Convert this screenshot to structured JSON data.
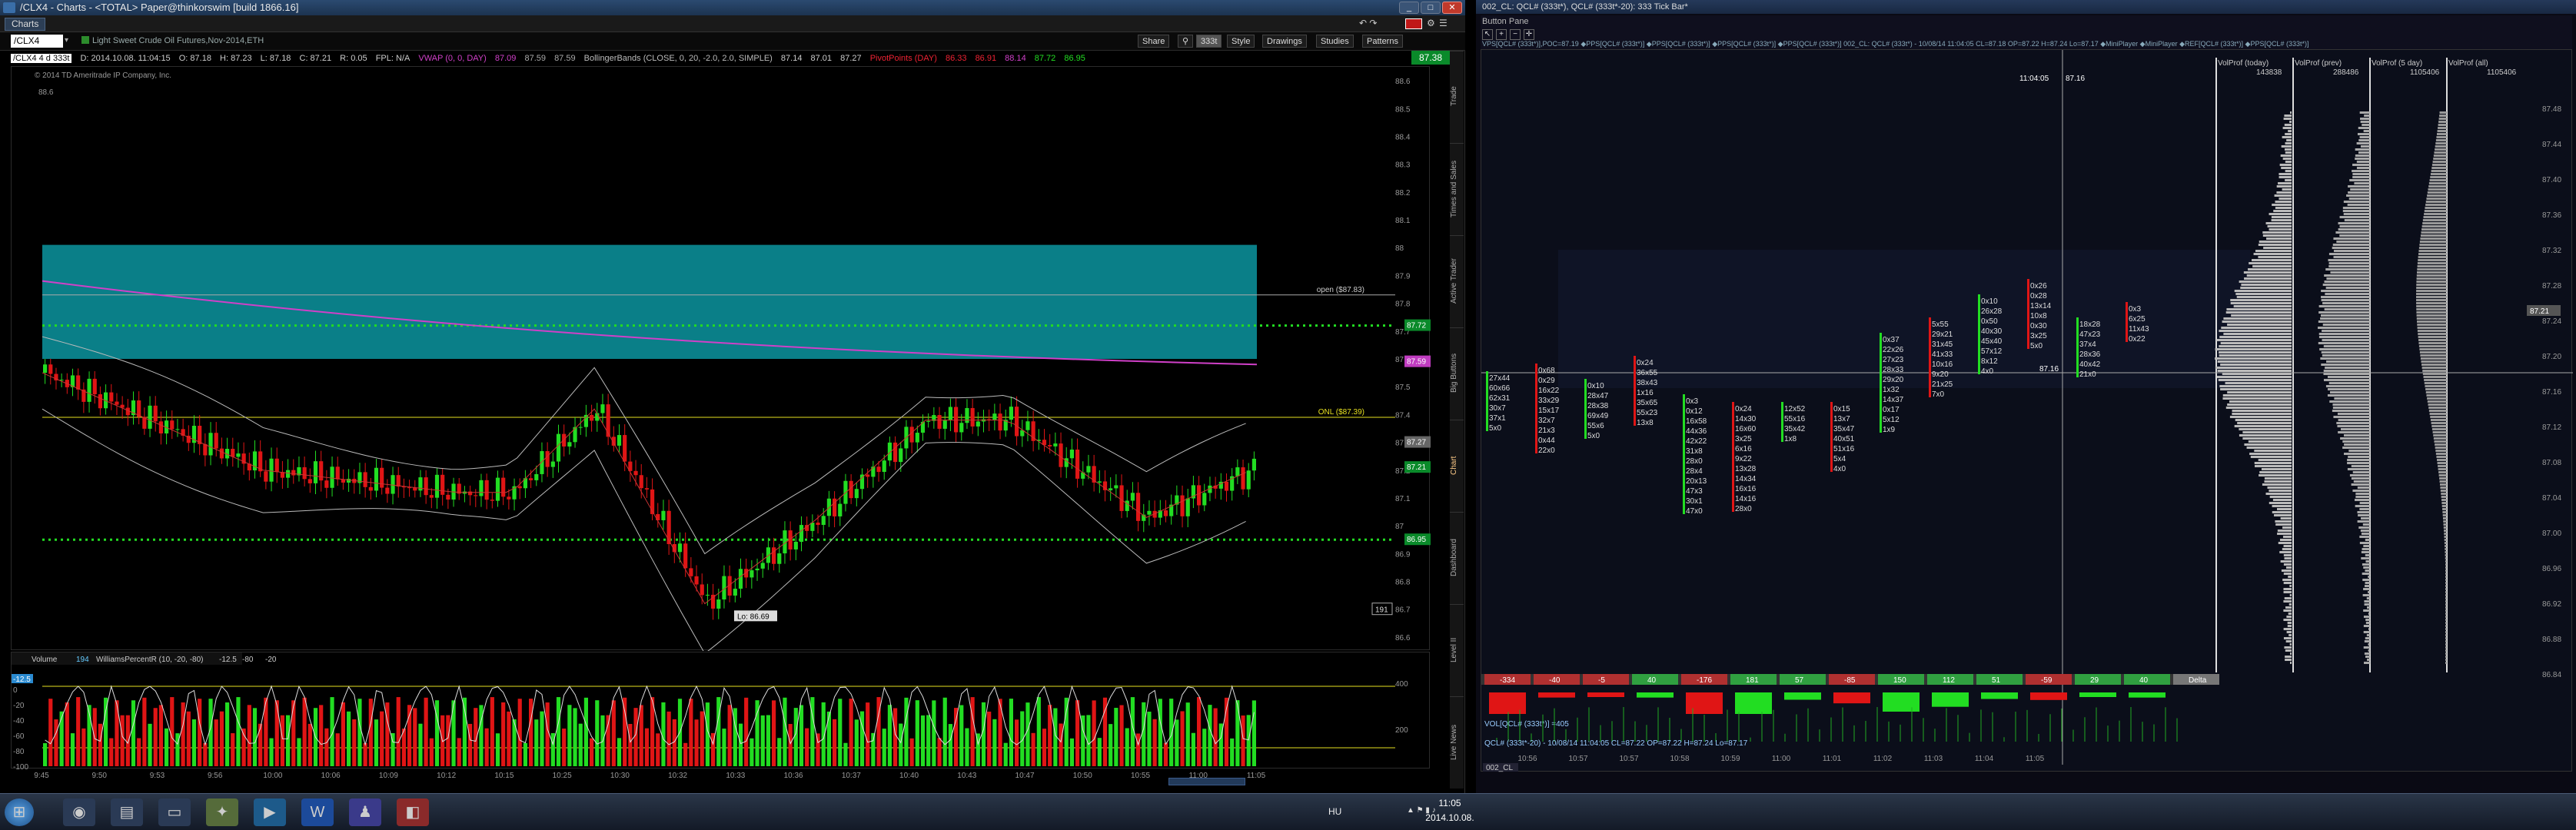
{
  "left_window": {
    "title": "/CLX4 - Charts - <TOTAL> Paper@thinkorswim [build 1866.16]",
    "charts_tab": "Charts",
    "symbol": "/CLX4",
    "description": "Light Sweet Crude Oil Futures,Nov-2014,ETH",
    "buttons": {
      "share": "Share",
      "interval": "333t",
      "style": "Style",
      "drawings": "Drawings",
      "studies": "Studies",
      "patterns": "Patterns"
    },
    "quote_line": {
      "symbol": "/CLX4 4 d 333t",
      "date": "D: 2014.10.08. 11:04:15",
      "open": "O: 87.18",
      "high": "H: 87.23",
      "low": "L: 87.18",
      "close": "C: 87.21",
      "rng": "R: 0.05",
      "fpl": "FPL: N/A",
      "vwap": "VWAP (0, 0, DAY)",
      "vwap_vals": [
        "87.09",
        "87.59",
        "87.59"
      ],
      "bb": "BollingerBands (CLOSE, 0, 20, -2.0, 2.0, SIMPLE)",
      "bb_vals": [
        "87.14",
        "87.01",
        "87.27"
      ],
      "pivot": "PivotPoints (DAY)",
      "pivot_vals": [
        "86.33",
        "86.91",
        "88.14",
        "87.72",
        "86.95"
      ]
    },
    "copyright": "© 2014 TD Ameritrade IP Company, Inc.",
    "last_price": "87.38",
    "annotations": {
      "open": "open ($87.83)",
      "onl": "ONL ($87.39)",
      "low": "Lo: 86.69",
      "ticks_left": "191"
    },
    "right_axis": [
      "88.6",
      "88.5",
      "88.4",
      "88.3",
      "88.2",
      "88.1",
      "88",
      "87.9",
      "87.8",
      "87.7",
      "87.6",
      "87.5",
      "87.4",
      "87.3",
      "87.2",
      "87.1",
      "87",
      "86.9",
      "86.8",
      "86.7",
      "86.6"
    ],
    "price_badges": [
      {
        "text": "87.72",
        "color": "#0a8a2a"
      },
      {
        "text": "87.59",
        "color": "#c03cc0"
      },
      {
        "text": "87.27",
        "color": "#666666"
      },
      {
        "text": "87.21",
        "color": "#0a8a2a"
      },
      {
        "text": "86.95",
        "color": "#0a8a2a"
      }
    ],
    "sub_header": {
      "volume": "Volume",
      "vol_val": "194",
      "wpr": "WilliamsPercentR (10, -20, -80)",
      "wpr_vals": [
        "-12.5",
        "-80",
        "-20"
      ]
    },
    "sub_axis": [
      "0",
      "-20",
      "-40",
      "-60",
      "-80",
      "-100"
    ],
    "sub_badge": "-12.5",
    "sub_right_axis": [
      "400",
      "200"
    ],
    "time_axis": [
      "9:45",
      "9:50",
      "9:53",
      "9:56",
      "10:00",
      "10:06",
      "10:09",
      "10:12",
      "10:15",
      "10:25",
      "10:30",
      "10:32",
      "10:33",
      "10:36",
      "10:37",
      "10:40",
      "10:43",
      "10:47",
      "10:50",
      "10:55",
      "11:00",
      "11:05"
    ],
    "side_tabs": [
      "Trade",
      "Times and Sales",
      "Active Trader",
      "Big Buttons",
      "Chart",
      "Dashboard",
      "Level II",
      "Live News"
    ]
  },
  "right_window": {
    "title": "002_CL: QCL# (333t*), QCL# (333t*-20): 333 Tick Bar*",
    "button_pane": "Button Pane",
    "header_line": "VPS[QCL# (333t*)],POC=87.19 ◆PPS[QCL# (333t*)] ◆PPS[QCL# (333t*)] ◆PPS[QCL# (333t*)] ◆PPS[QCL# (333t*)] 002_CL: QCL# (333t*) - 10/08/14 11:04:05 CL=87.18 OP=87.22 H=87.24 Lo=87.17 ◆MiniPlayer ◆MiniPlayer ◆REF[QCL# (333t*)] ◆PPS[QCL# (333t*)]",
    "time_header": "11:04:05",
    "price_header": "87.16",
    "crosshair_price": "87.16",
    "vol_profiles": [
      {
        "name": "VolProf (today)",
        "value": "143838"
      },
      {
        "name": "VolProf (prev)",
        "value": "288486"
      },
      {
        "name": "VolProf (5 day)",
        "value": "1105406"
      },
      {
        "name": "VolProf (all)",
        "value": "1105406"
      }
    ],
    "price_axis": [
      "87.48",
      "87.44",
      "87.40",
      "87.36",
      "87.32",
      "87.28",
      "87.24",
      "87.20",
      "87.16",
      "87.12",
      "87.08",
      "87.04",
      "87.00",
      "86.96",
      "86.92",
      "86.88",
      "86.84"
    ],
    "last_badge": "87.21",
    "delta_values": [
      "-334",
      "-40",
      "-5",
      "40",
      "-176",
      "181",
      "57",
      "-85",
      "150",
      "112",
      "51",
      "-59",
      "29",
      "40",
      "Delta"
    ],
    "lower_pane1": "VOL[QCL# (333t*)] =405",
    "lower_pane2": "QCL# (333t*-20) - 10/08/14 11:04:05 CL=87.22 OP=87.22 H=87.24 Lo=87.17",
    "tab_label": "002_CL",
    "time_axis": [
      "10:56",
      "10:57",
      "10:57",
      "10:58",
      "10:59",
      "11:00",
      "11:01",
      "11:02",
      "11:03",
      "11:04",
      "11:05"
    ],
    "footprint_cols": [
      [
        "27x44",
        "60x66",
        "62x31",
        "30x7",
        "37x1",
        "5x0"
      ],
      [
        "0x68",
        "0x29",
        "16x22",
        "33x29",
        "15x17",
        "32x7",
        "21x3",
        "0x44",
        "22x0"
      ],
      [
        "0x10",
        "28x47",
        "28x38",
        "69x49",
        "55x6",
        "5x0"
      ],
      [
        "0x24",
        "36x55",
        "38x43",
        "1x16",
        "35x65",
        "55x23",
        "13x8"
      ],
      [
        "0x3",
        "0x12",
        "16x58",
        "44x36",
        "42x22",
        "31x8",
        "28x0",
        "28x4",
        "20x13",
        "47x3",
        "30x1",
        "47x0"
      ],
      [
        "0x24",
        "14x30",
        "16x60",
        "3x25",
        "6x16",
        "9x22",
        "13x28",
        "14x34",
        "16x16",
        "14x16",
        "28x0"
      ],
      [
        "12x52",
        "55x16",
        "35x42",
        "1x8"
      ],
      [
        "0x15",
        "13x7",
        "35x47",
        "40x51",
        "51x16",
        "5x4",
        "4x0"
      ],
      [
        "0x37",
        "22x26",
        "27x23",
        "28x33",
        "29x20",
        "1x32",
        "14x37",
        "0x17",
        "5x12",
        "1x9"
      ],
      [
        "5x55",
        "29x21",
        "31x45",
        "41x33",
        "10x16",
        "9x20",
        "21x25",
        "7x0"
      ],
      [
        "0x10",
        "26x28",
        "0x50",
        "40x30",
        "45x40",
        "57x12",
        "8x12",
        "4x0"
      ],
      [
        "0x26",
        "0x28",
        "13x14",
        "10x8",
        "0x30",
        "3x25",
        "5x0"
      ],
      [
        "18x28",
        "47x23",
        "37x4",
        "28x36",
        "40x42",
        "21x0"
      ],
      [
        "0x3",
        "6x25",
        "11x43",
        "0x22"
      ]
    ]
  },
  "taskbar": {
    "lang": "HU",
    "time": "11:05",
    "date": "2014.10.08."
  },
  "colors": {
    "up": "#22dd22",
    "down": "#e01515",
    "cloud": "#0a7f88",
    "magenta": "#d040c8",
    "green_dot": "#22dd22",
    "yellow": "#e6e020"
  }
}
